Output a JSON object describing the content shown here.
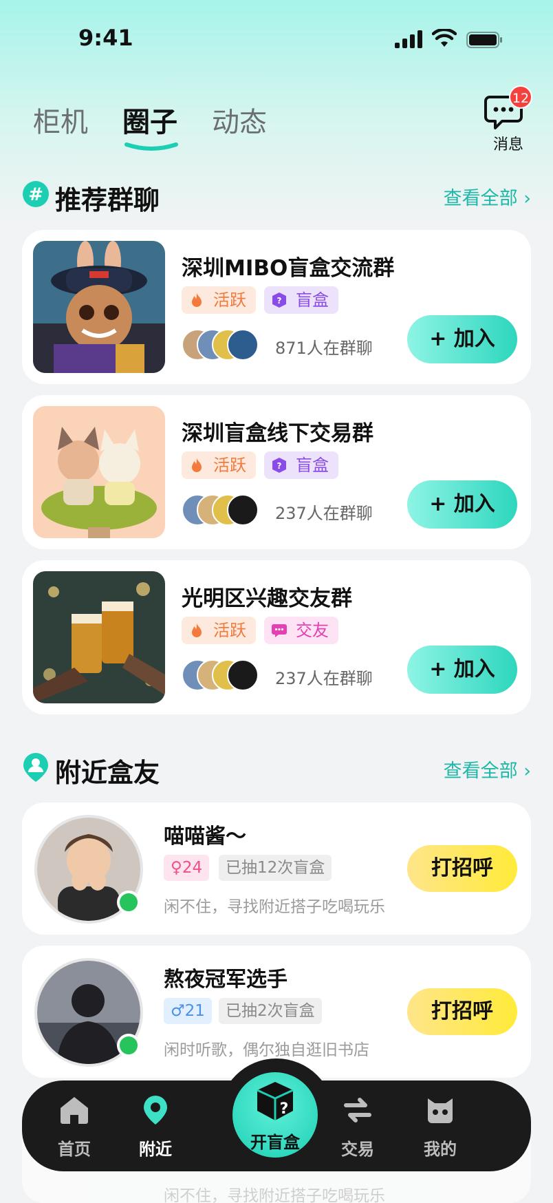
{
  "status_bar": {
    "time": "9:41"
  },
  "top_tabs": [
    {
      "label": "柜机",
      "active": false
    },
    {
      "label": "圈子",
      "active": true
    },
    {
      "label": "动态",
      "active": false
    }
  ],
  "messages": {
    "label": "消息",
    "badge": "12"
  },
  "groups_section": {
    "title": "推荐群聊",
    "more": "查看全部"
  },
  "groups": [
    {
      "name": "深圳MIBO盲盒交流群",
      "tag1": "活跃",
      "tag2": "盲盒",
      "members": "871人在群聊",
      "join": "+ 加入"
    },
    {
      "name": "深圳盲盒线下交易群",
      "tag1": "活跃",
      "tag2": "盲盒",
      "members": "237人在群聊",
      "join": "+ 加入"
    },
    {
      "name": "光明区兴趣交友群",
      "tag1": "活跃",
      "tag2": "交友",
      "members": "237人在群聊",
      "join": "+ 加入"
    }
  ],
  "nearby_section": {
    "title": "附近盒友",
    "more": "查看全部"
  },
  "nearby": [
    {
      "name": "喵喵酱～",
      "gender": "♀24",
      "draws": "已抽12次盲盒",
      "bio": "闲不住，寻找附近搭子吃喝玩乐",
      "action": "打招呼"
    },
    {
      "name": "熬夜冠军选手",
      "gender": "♂21",
      "draws": "已抽2次盲盒",
      "bio": "闲时听歌，偶尔独自逛旧书店",
      "action": "打招呼"
    }
  ],
  "ghost_bio": "闲不住，寻找附近搭子吃喝玩乐",
  "nav": {
    "home": "首页",
    "nearby": "附近",
    "center": "开盲盒",
    "trade": "交易",
    "mine": "我的"
  },
  "colors": {
    "accent": "#1fb8a8",
    "join_gradient_end": "#2ed6bd",
    "hello": "#ffeb3a",
    "online": "#27c45b",
    "badge": "#f5413d"
  }
}
